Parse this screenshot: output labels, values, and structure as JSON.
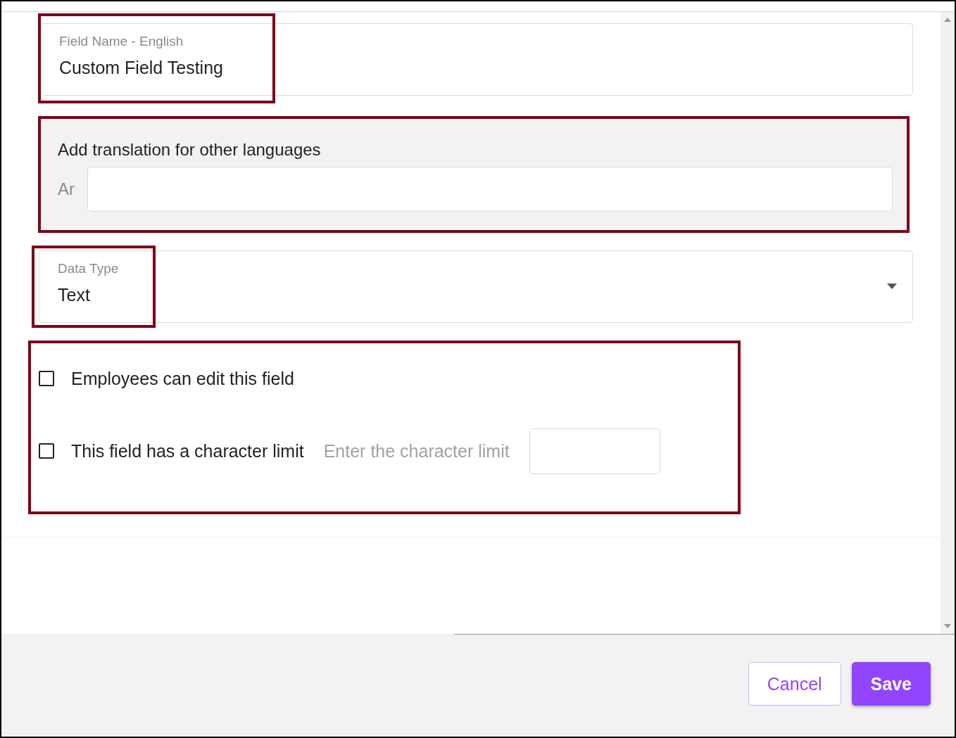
{
  "field_name": {
    "label": "Field Name - English",
    "value": "Custom Field Testing"
  },
  "translations": {
    "title": "Add translation for other languages",
    "languages": [
      {
        "code": "Ar"
      }
    ]
  },
  "data_type": {
    "label": "Data Type",
    "value": "Text"
  },
  "options": [
    {
      "label": "Employees can edit this field",
      "checked": false
    },
    {
      "label": "This field has a character limit",
      "checked": false,
      "limit_placeholder": "Enter the character limit"
    }
  ],
  "buttons": [
    {
      "label": "Cancel",
      "kind": "secondary"
    },
    {
      "label": "Save",
      "kind": "primary"
    }
  ]
}
